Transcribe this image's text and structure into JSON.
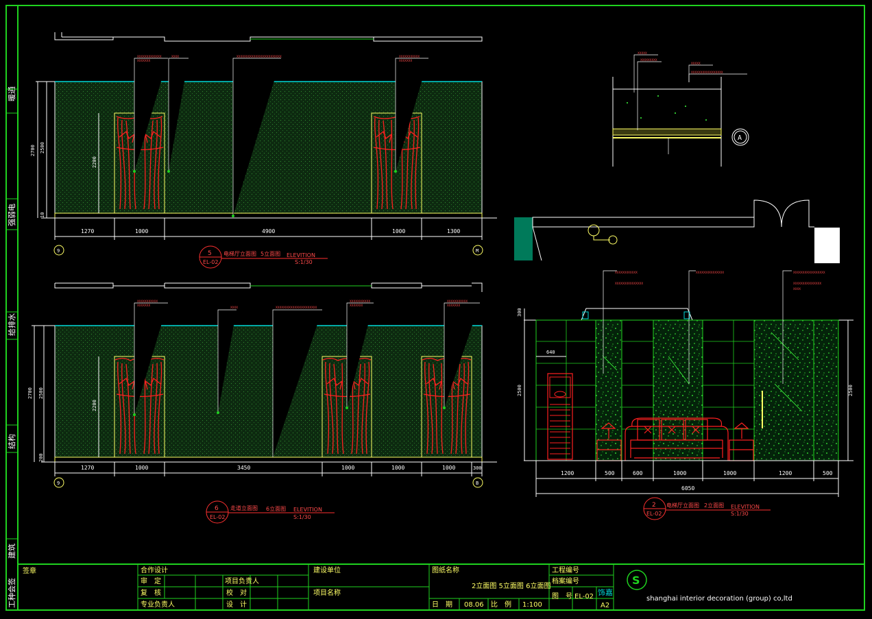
{
  "stamp_label": "签章",
  "side_labels": [
    "暖通",
    "强弱电",
    "给排水",
    "结构",
    "建筑",
    "工种会签"
  ],
  "title_block": {
    "coop_design": "合作设计",
    "review": "审　定",
    "recheck": "复　核",
    "discipline_lead": "专业负责人",
    "project_lead": "项目负责人",
    "check": "校　对",
    "design": "设　计",
    "client": "建设单位",
    "project_name": "项目名称",
    "drawing_name_label": "图纸名称",
    "drawing_name": "2立面图 5立面图 6立面图",
    "date_label": "日　期",
    "date": "08.06",
    "scale_label": "比　例",
    "scale": "1:100",
    "project_no_label": "工程编号",
    "archive_no_label": "档案编号",
    "sheet_label": "图　号",
    "sheet_no": "EL-02",
    "paper": "A2",
    "company_mark": "饰嘉",
    "company": "shanghai interior decoration (group) co,ltd"
  },
  "elevations": [
    {
      "num": "5",
      "ref": "EL-02",
      "title": "电梯厅立面图",
      "sub": "5立面图",
      "label": "ELEVITION",
      "scale": "S:1/30",
      "dims": [
        "1270",
        "1000",
        "4900",
        "1000",
        "1300"
      ],
      "height_dims": [
        "2700",
        "2500",
        "2200",
        "10",
        "200"
      ],
      "axis_left": "9",
      "axis_right": "M"
    },
    {
      "num": "6",
      "ref": "EL-02",
      "title": "走道立面图",
      "sub": "6立面图",
      "label": "ELEVITION",
      "scale": "S:1/30",
      "dims": [
        "1270",
        "1000",
        "3450",
        "1000",
        "1000",
        "1000",
        "300"
      ],
      "height_dims": [
        "2700",
        "2500",
        "2200",
        "200"
      ],
      "axis_left": "9",
      "axis_right": "B"
    },
    {
      "num": "2",
      "ref": "EL-02",
      "title": "电梯厅立面图",
      "sub": "2立面图",
      "label": "ELEVITION",
      "scale": "S:1/30",
      "dims": [
        "1200",
        "500",
        "600",
        "1000",
        "1000",
        "1200",
        "500"
      ],
      "total": "6050",
      "height_dims": [
        "300",
        "2500",
        "2500"
      ],
      "small_dim": "640"
    }
  ],
  "detail": {
    "marker": "A"
  }
}
